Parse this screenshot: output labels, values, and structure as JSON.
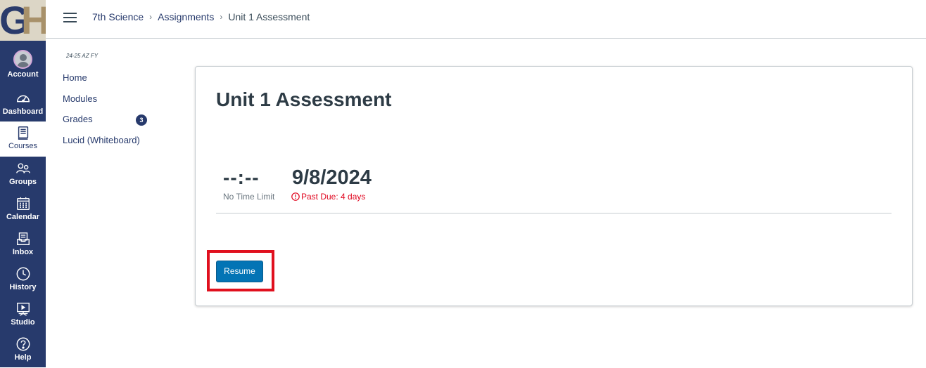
{
  "logo": {
    "letters": [
      "G",
      "H"
    ]
  },
  "global_nav": [
    {
      "label": "Account",
      "icon": "account-avatar-icon"
    },
    {
      "label": "Dashboard",
      "icon": "dashboard-gauge-icon"
    },
    {
      "label": "Courses",
      "icon": "book-icon",
      "active": true
    },
    {
      "label": "Groups",
      "icon": "groups-icon"
    },
    {
      "label": "Calendar",
      "icon": "calendar-icon"
    },
    {
      "label": "Inbox",
      "icon": "inbox-icon"
    },
    {
      "label": "History",
      "icon": "clock-icon"
    },
    {
      "label": "Studio",
      "icon": "studio-icon"
    },
    {
      "label": "Help",
      "icon": "help-icon"
    }
  ],
  "breadcrumbs": [
    "7th Science",
    "Assignments",
    "Unit 1 Assessment"
  ],
  "course_nav": {
    "term": "24-25 AZ FY",
    "items": [
      {
        "label": "Home"
      },
      {
        "label": "Modules"
      },
      {
        "label": "Grades",
        "badge": "3"
      },
      {
        "label": "Lucid (Whiteboard)"
      }
    ]
  },
  "assessment": {
    "title": "Unit 1 Assessment",
    "timer": "--:--",
    "timer_label": "No Time Limit",
    "due_date": "9/8/2024",
    "due_status": "Past Due: 4 days",
    "resume_label": "Resume"
  },
  "colors": {
    "nav_bg": "#273a6c",
    "primary_button": "#0374b5",
    "danger": "#e0061f",
    "highlight": "#e0101e"
  }
}
